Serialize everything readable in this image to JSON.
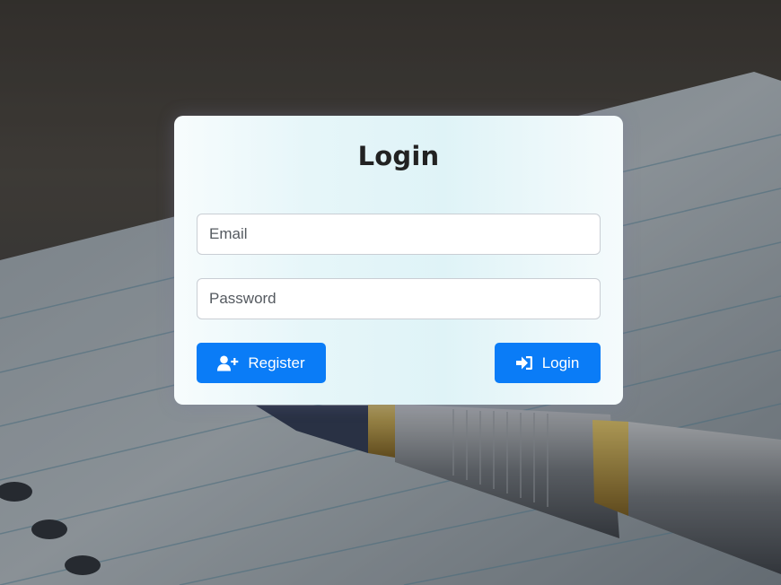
{
  "form": {
    "title": "Login",
    "email_placeholder": "Email",
    "password_placeholder": "Password",
    "register_label": "Register",
    "login_label": "Login"
  },
  "icons": {
    "register": "user-plus-icon",
    "login": "sign-in-icon"
  },
  "colors": {
    "button": "#0a7cf7",
    "title": "#222222"
  }
}
